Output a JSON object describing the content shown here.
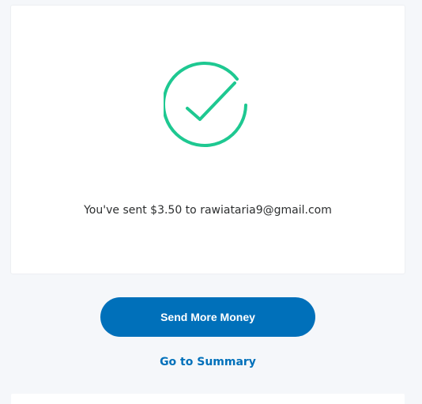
{
  "confirmation": {
    "icon": "check-circle-icon",
    "accent_color": "#1ec891",
    "message": "You've sent $3.50 to rawiataria9@gmail.com"
  },
  "actions": {
    "send_more_label": "Send More Money",
    "summary_link_label": "Go to Summary",
    "brand_color": "#0070ba"
  }
}
